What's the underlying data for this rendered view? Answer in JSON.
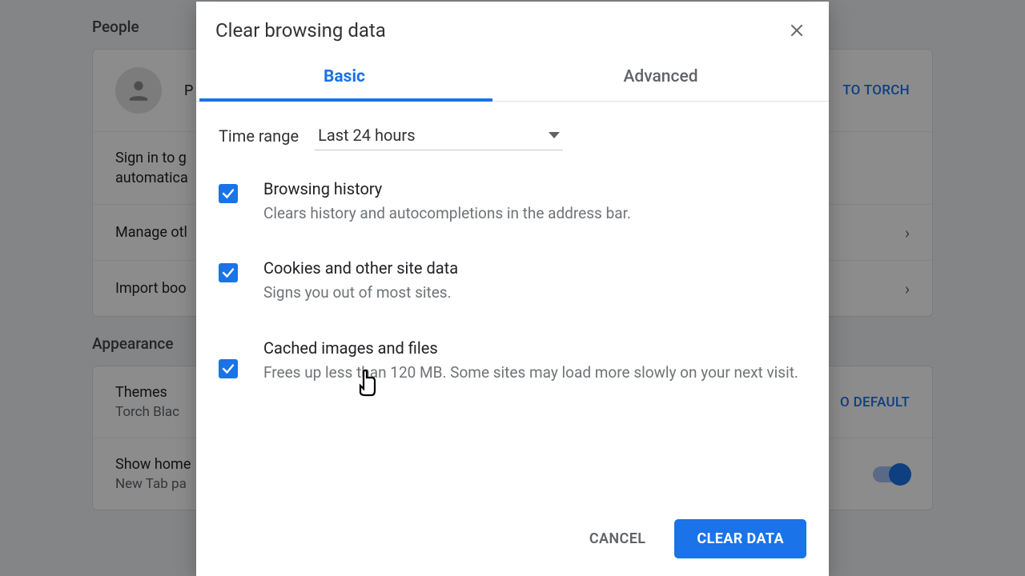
{
  "background": {
    "section_people": "People",
    "section_appearance": "Appearance",
    "person_label_partial": "P",
    "sign_in_to_torch": "TO TORCH",
    "sign_in_line1": "Sign in to g",
    "sign_in_line2": "automatica",
    "manage_other": "Manage otl",
    "import_bookmarks": "Import boo",
    "themes_title": "Themes",
    "themes_sub": "Torch Blac",
    "reset_default": "O DEFAULT",
    "show_home": "Show home",
    "new_tab_partial": "New Tab pa"
  },
  "modal": {
    "title": "Clear browsing data",
    "tabs": {
      "basic": "Basic",
      "advanced": "Advanced"
    },
    "time_range_label": "Time range",
    "time_range_value": "Last 24 hours",
    "options": [
      {
        "title": "Browsing history",
        "sub": "Clears history and autocompletions in the address bar."
      },
      {
        "title": "Cookies and other site data",
        "sub": "Signs you out of most sites."
      },
      {
        "title": "Cached images and files",
        "sub": "Frees up less than 120 MB. Some sites may load more slowly on your next visit."
      }
    ],
    "cancel": "CANCEL",
    "clear": "CLEAR DATA"
  }
}
